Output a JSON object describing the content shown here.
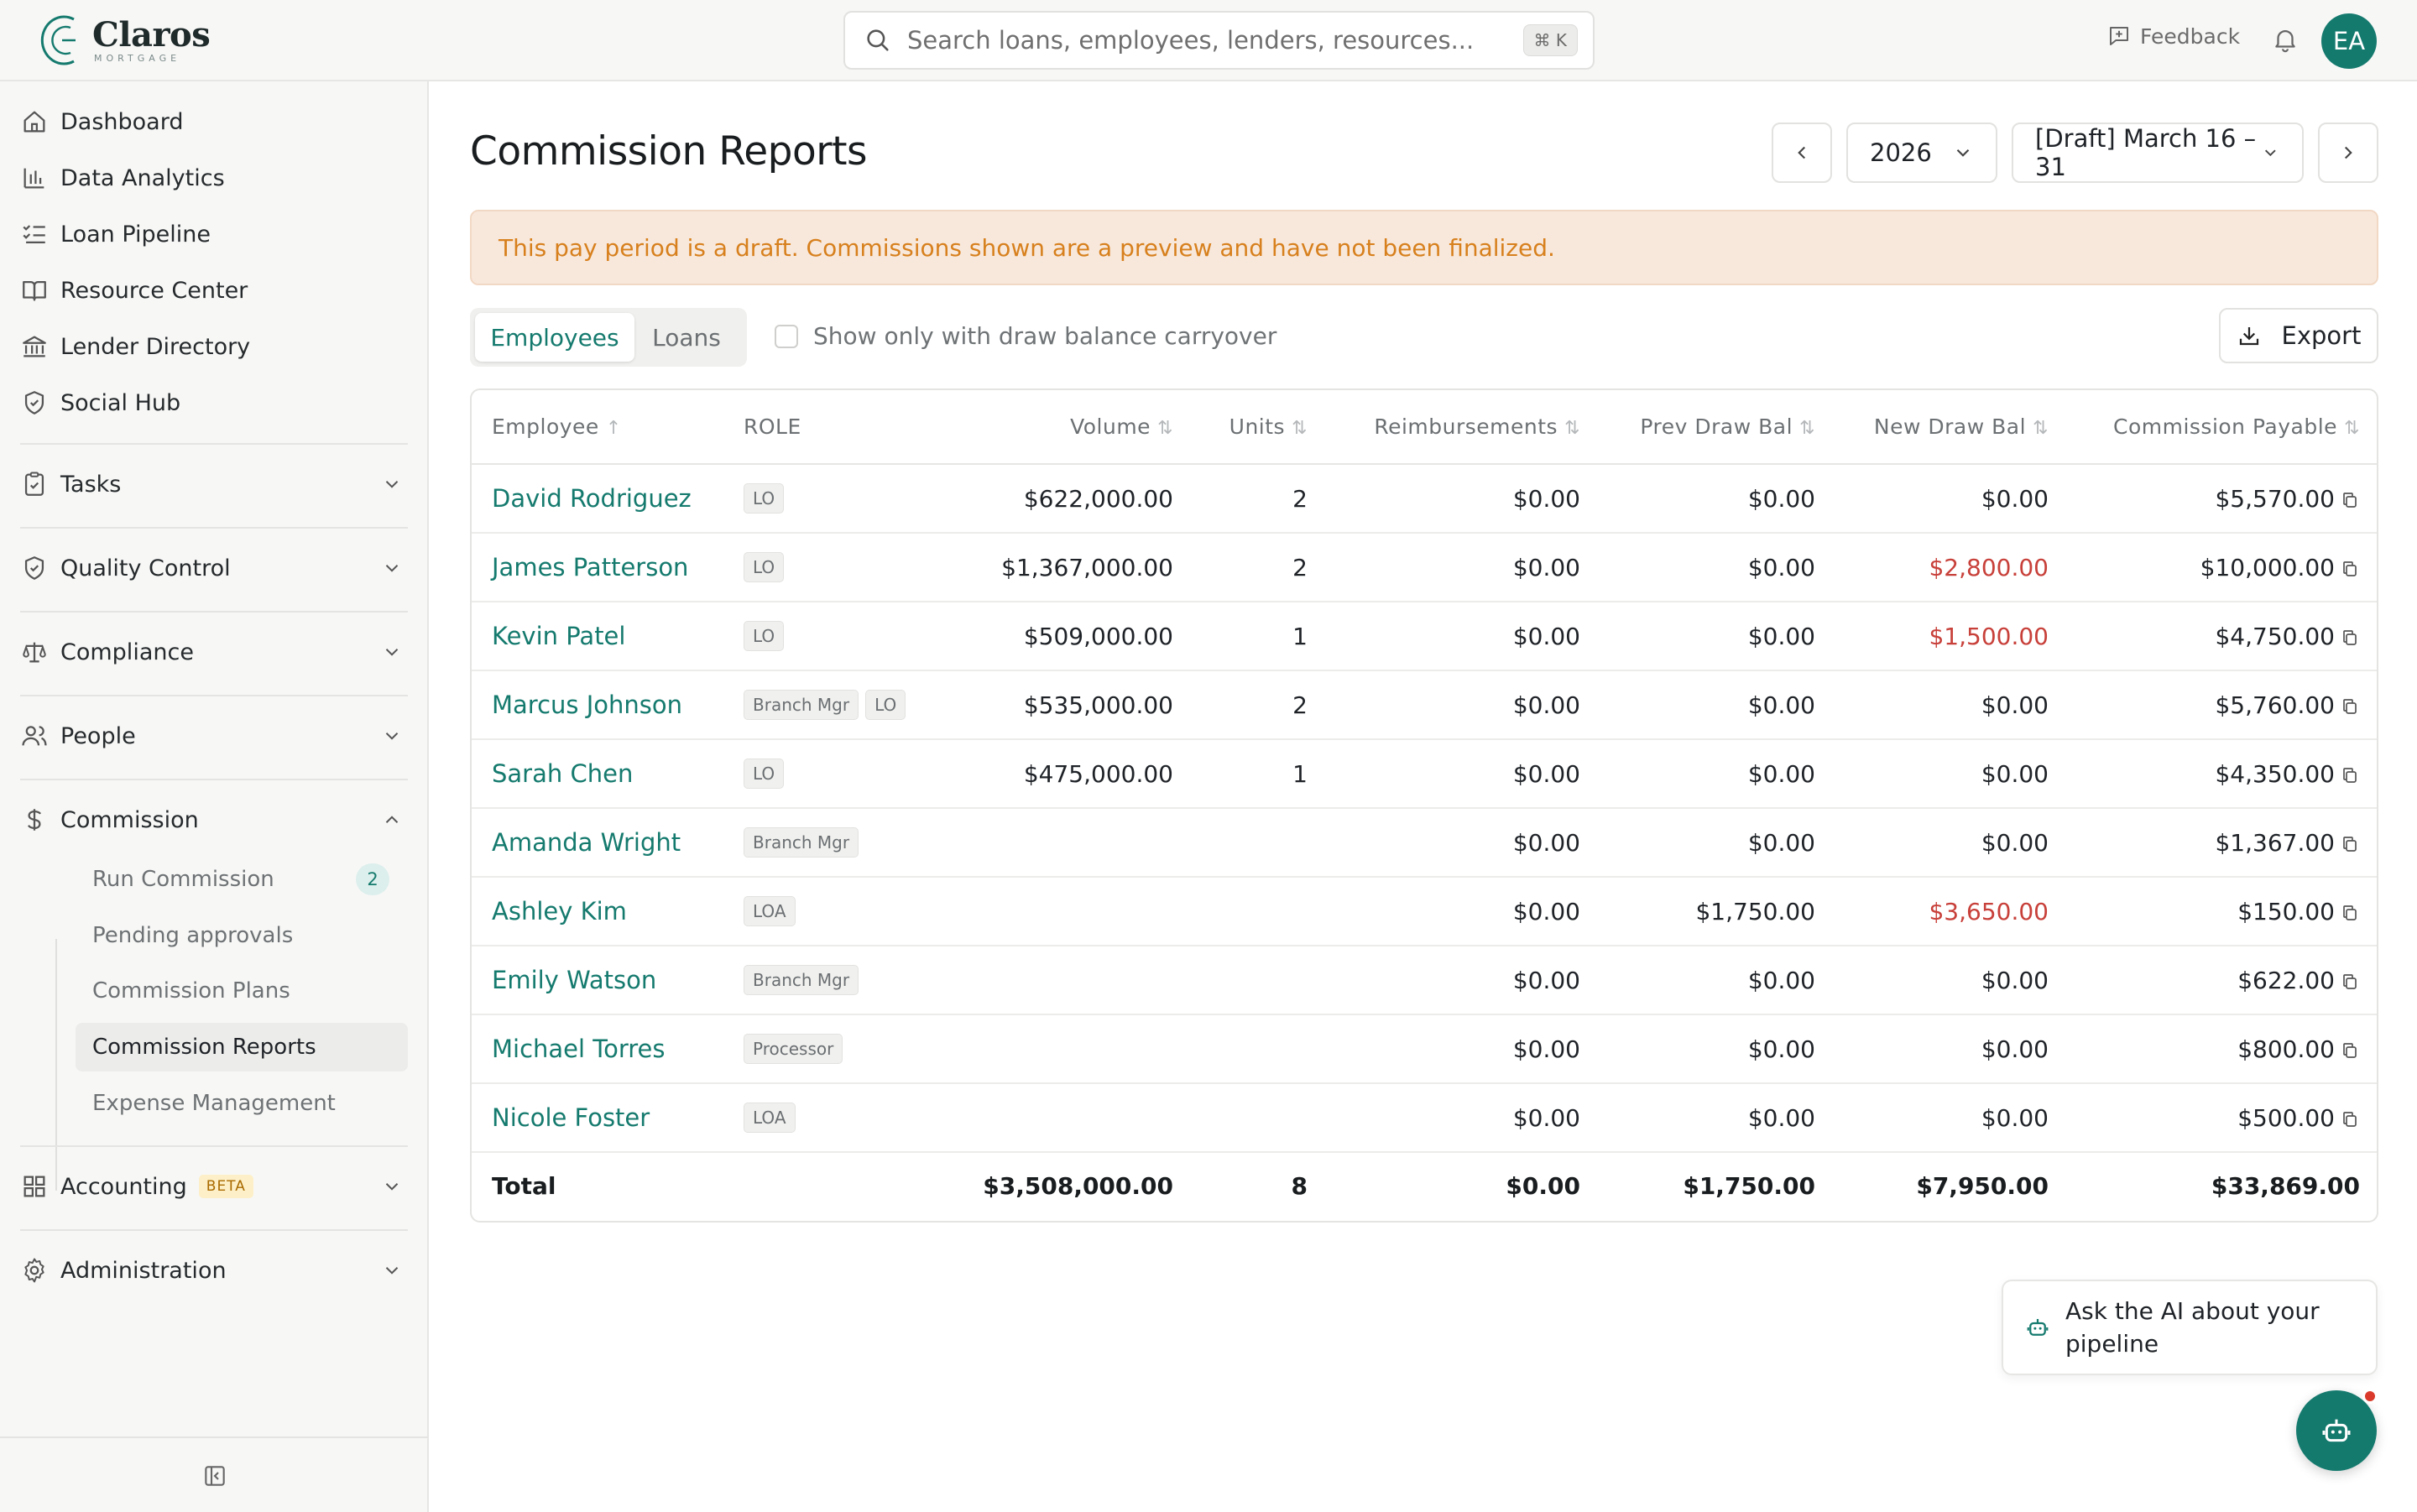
{
  "brand": {
    "name": "Claros",
    "sub": "MORTGAGE",
    "color": "#157a6e"
  },
  "search": {
    "placeholder": "Search loans, employees, lenders, resources...",
    "shortcut": "⌘ K"
  },
  "header": {
    "feedback": "Feedback",
    "avatar_initials": "EA"
  },
  "sidebar": {
    "items": [
      {
        "label": "Dashboard",
        "icon": "home-icon"
      },
      {
        "label": "Data Analytics",
        "icon": "bar-chart-icon"
      },
      {
        "label": "Loan Pipeline",
        "icon": "list-check-icon"
      },
      {
        "label": "Resource Center",
        "icon": "book-icon"
      },
      {
        "label": "Lender Directory",
        "icon": "bank-icon"
      },
      {
        "label": "Social Hub",
        "icon": "badge-icon"
      }
    ],
    "sections": [
      {
        "label": "Tasks",
        "icon": "clipboard-icon"
      },
      {
        "label": "Quality Control",
        "icon": "shield-check-icon"
      },
      {
        "label": "Compliance",
        "icon": "scale-icon"
      },
      {
        "label": "People",
        "icon": "people-icon"
      },
      {
        "label": "Commission",
        "icon": "dollar-icon"
      },
      {
        "label": "Accounting",
        "icon": "grid-icon",
        "badge": "BETA"
      },
      {
        "label": "Administration",
        "icon": "gear-icon"
      }
    ],
    "commission_sub": [
      {
        "label": "Run Commission",
        "count": "2"
      },
      {
        "label": "Pending approvals"
      },
      {
        "label": "Commission Plans"
      },
      {
        "label": "Commission Reports",
        "active": true
      },
      {
        "label": "Expense Management"
      }
    ]
  },
  "page": {
    "title": "Commission Reports",
    "year": "2026",
    "period": "[Draft] March 16 – 31",
    "banner": "This pay period is a draft. Commissions shown are a preview and have not been finalized.",
    "tabs": [
      "Employees",
      "Loans"
    ],
    "checkbox_label": "Show only with draw balance carryover",
    "export_label": "Export"
  },
  "table": {
    "headers": [
      "Employee",
      "ROLE",
      "Volume",
      "Units",
      "Reimbursements",
      "Prev Draw Bal",
      "New Draw Bal",
      "Commission Payable"
    ],
    "rows": [
      {
        "name": "David Rodriguez",
        "roles": [
          "LO"
        ],
        "volume": "$622,000.00",
        "units": "2",
        "reimb": "$0.00",
        "prev": "$0.00",
        "new": "$0.00",
        "payable": "$5,570.00"
      },
      {
        "name": "James Patterson",
        "roles": [
          "LO"
        ],
        "volume": "$1,367,000.00",
        "units": "2",
        "reimb": "$0.00",
        "prev": "$0.00",
        "new": "$2,800.00",
        "payable": "$10,000.00"
      },
      {
        "name": "Kevin Patel",
        "roles": [
          "LO"
        ],
        "volume": "$509,000.00",
        "units": "1",
        "reimb": "$0.00",
        "prev": "$0.00",
        "new": "$1,500.00",
        "payable": "$4,750.00"
      },
      {
        "name": "Marcus Johnson",
        "roles": [
          "Branch Mgr",
          "LO"
        ],
        "volume": "$535,000.00",
        "units": "2",
        "reimb": "$0.00",
        "prev": "$0.00",
        "new": "$0.00",
        "payable": "$5,760.00"
      },
      {
        "name": "Sarah Chen",
        "roles": [
          "LO"
        ],
        "volume": "$475,000.00",
        "units": "1",
        "reimb": "$0.00",
        "prev": "$0.00",
        "new": "$0.00",
        "payable": "$4,350.00"
      },
      {
        "name": "Amanda Wright",
        "roles": [
          "Branch Mgr"
        ],
        "volume": "",
        "units": "",
        "reimb": "$0.00",
        "prev": "$0.00",
        "new": "$0.00",
        "payable": "$1,367.00"
      },
      {
        "name": "Ashley Kim",
        "roles": [
          "LOA"
        ],
        "volume": "",
        "units": "",
        "reimb": "$0.00",
        "prev": "$1,750.00",
        "new": "$3,650.00",
        "payable": "$150.00"
      },
      {
        "name": "Emily Watson",
        "roles": [
          "Branch Mgr"
        ],
        "volume": "",
        "units": "",
        "reimb": "$0.00",
        "prev": "$0.00",
        "new": "$0.00",
        "payable": "$622.00"
      },
      {
        "name": "Michael Torres",
        "roles": [
          "Processor"
        ],
        "volume": "",
        "units": "",
        "reimb": "$0.00",
        "prev": "$0.00",
        "new": "$0.00",
        "payable": "$800.00"
      },
      {
        "name": "Nicole Foster",
        "roles": [
          "LOA"
        ],
        "volume": "",
        "units": "",
        "reimb": "$0.00",
        "prev": "$0.00",
        "new": "$0.00",
        "payable": "$500.00"
      }
    ],
    "total": {
      "label": "Total",
      "volume": "$3,508,000.00",
      "units": "8",
      "reimb": "$0.00",
      "prev": "$1,750.00",
      "new": "$7,950.00",
      "payable": "$33,869.00"
    }
  },
  "ai": {
    "prompt": "Ask the AI about your pipeline"
  },
  "colors": {
    "accent": "#157a6e",
    "negative": "#c8403a",
    "warning_text": "#d7801d",
    "warning_bg": "#f8e8dc"
  }
}
